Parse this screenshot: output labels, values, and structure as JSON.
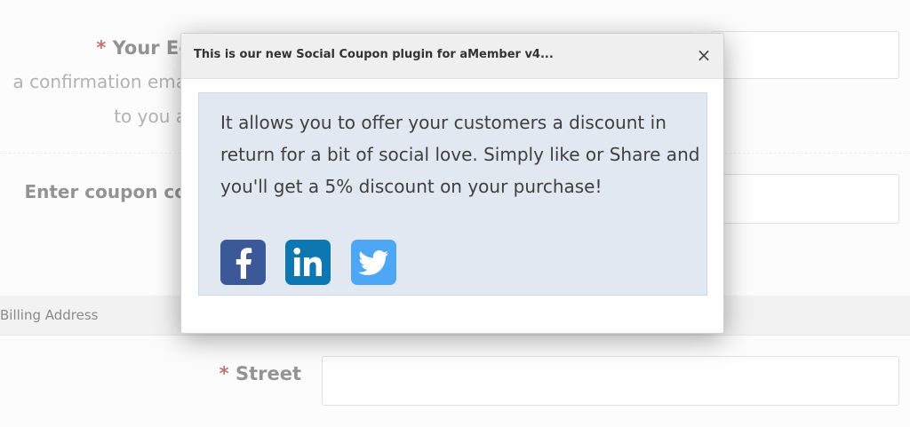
{
  "form": {
    "email": {
      "required_mark": "*",
      "label": "Your E-",
      "hint_line1": "a confirmation ema",
      "hint_line2": "to you a"
    },
    "coupon": {
      "label": "Enter coupon co"
    },
    "billing_section": {
      "title": "Billing Address"
    },
    "street": {
      "required_mark": "*",
      "label": "Street"
    }
  },
  "modal": {
    "title": "This is our new Social Coupon plugin for aMember v4...",
    "close_glyph": "×",
    "message": "It allows you to offer your customers a discount in return for a bit of social love. Simply like or Share and you'll get a 5% discount on your purchase!",
    "social_buttons": [
      {
        "name": "facebook",
        "icon": "facebook-icon",
        "color": "#3b5998"
      },
      {
        "name": "linkedin",
        "icon": "linkedin-icon",
        "color": "#0e76b1"
      },
      {
        "name": "twitter",
        "icon": "twitter-icon",
        "color": "#4da7f4"
      }
    ]
  }
}
